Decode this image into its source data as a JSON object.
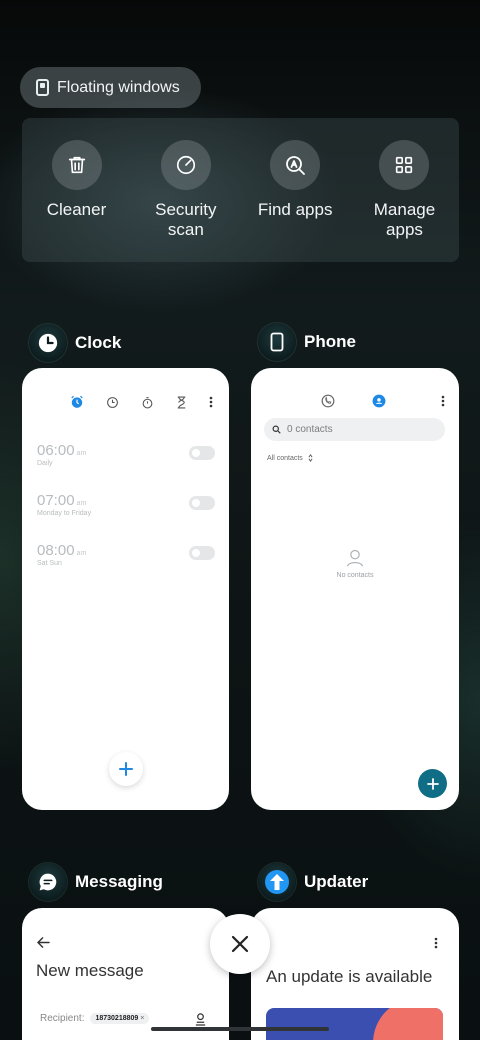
{
  "floating_windows": {
    "label": "Floating windows",
    "icon": "floating-window-icon"
  },
  "shortcuts": [
    {
      "label": "Cleaner",
      "icon": "trash-icon"
    },
    {
      "label": "Security\nscan",
      "icon": "shield-scan-icon"
    },
    {
      "label": "Find apps",
      "icon": "find-apps-icon"
    },
    {
      "label": "Manage\napps",
      "icon": "grid-icon"
    }
  ],
  "cards": {
    "clock": {
      "name": "Clock",
      "toolbar_icons": [
        "alarm-icon",
        "clock-icon",
        "stopwatch-icon",
        "timer-icon",
        "more-icon"
      ],
      "alarms": [
        {
          "time": "06:00",
          "ampm": "am",
          "repeat": "Daily",
          "enabled": false
        },
        {
          "time": "07:00",
          "ampm": "am",
          "repeat": "Monday to Friday",
          "enabled": false
        },
        {
          "time": "08:00",
          "ampm": "am",
          "repeat": "Sat Sun",
          "enabled": false
        }
      ]
    },
    "phone": {
      "name": "Phone",
      "search_placeholder": "0 contacts",
      "filter_label": "All contacts",
      "empty_text": "No contacts"
    },
    "messaging": {
      "name": "Messaging",
      "title": "New message",
      "recipient_label": "Recipient:",
      "recipient_chip": "18730218809",
      "chip_close": "×"
    },
    "updater": {
      "name": "Updater",
      "title": "An update is available"
    }
  },
  "colors": {
    "accent_blue": "#1e88e5",
    "fab_teal": "#0f6e86",
    "banner_blue": "#3b4fb0",
    "banner_coral": "#ee7066"
  }
}
